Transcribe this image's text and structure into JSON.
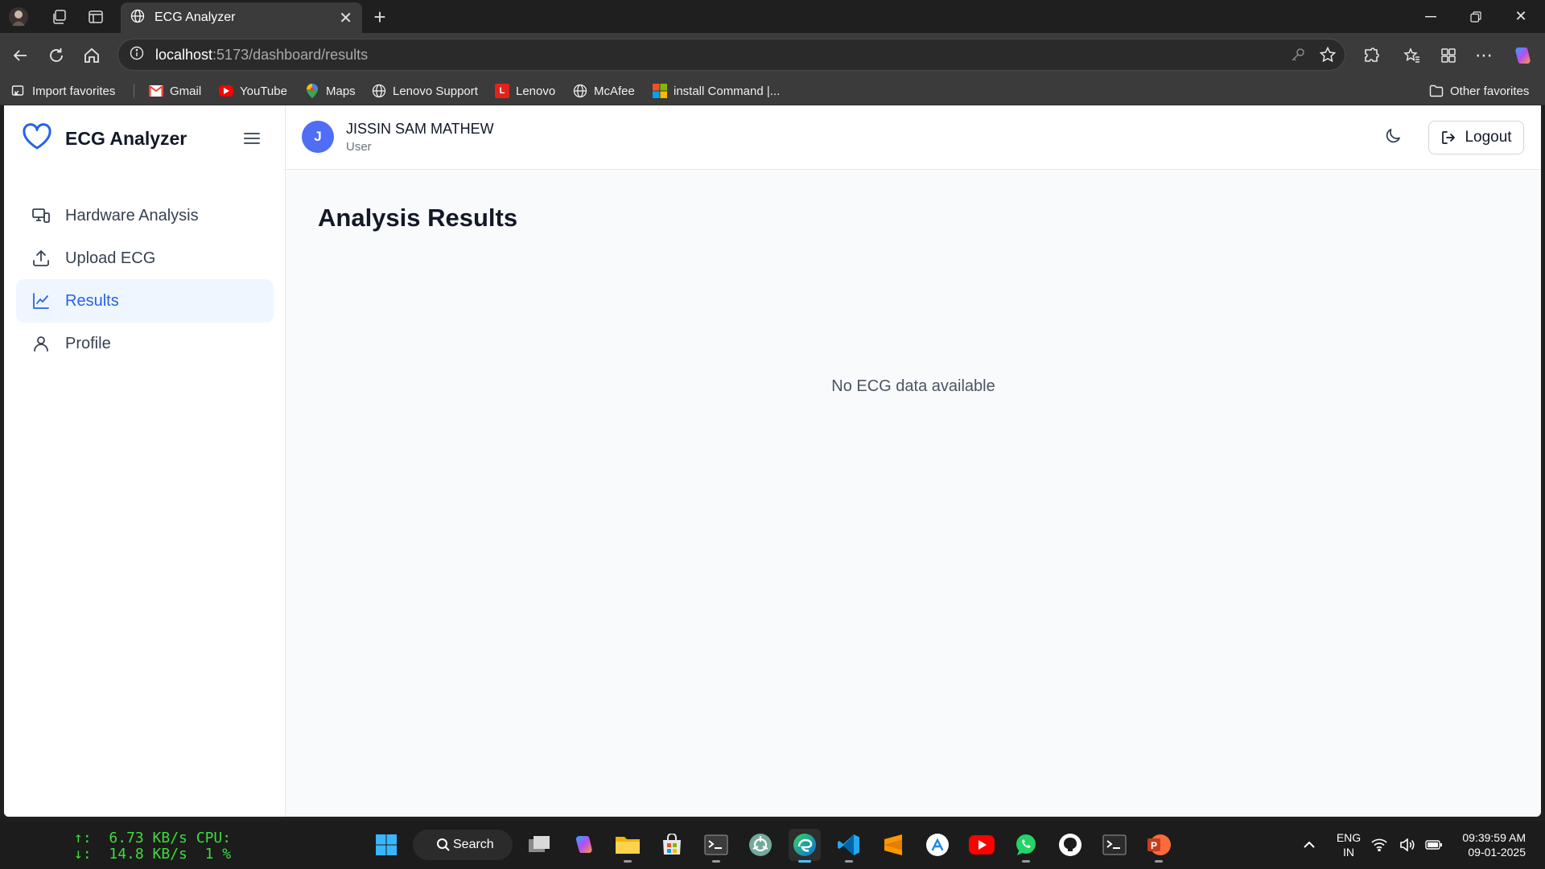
{
  "browser": {
    "tab_title": "ECG Analyzer",
    "url_host": "localhost",
    "url_path": ":5173/dashboard/results",
    "bookmarks": [
      {
        "label": "Import favorites",
        "icon": "import-icon"
      },
      {
        "label": "Gmail",
        "icon": "gmail-icon",
        "color": "#ea4335"
      },
      {
        "label": "YouTube",
        "icon": "youtube-icon",
        "color": "#ff0000"
      },
      {
        "label": "Maps",
        "icon": "maps-icon",
        "color": "#34a853"
      },
      {
        "label": "Lenovo Support",
        "icon": "globe-icon"
      },
      {
        "label": "Lenovo",
        "icon": "lenovo-icon",
        "color": "#e2231a"
      },
      {
        "label": "McAfee",
        "icon": "globe-icon"
      },
      {
        "label": "install Command |...",
        "icon": "microsoft-icon"
      }
    ],
    "other_favorites": "Other favorites"
  },
  "app": {
    "brand_name": "ECG Analyzer",
    "accent_color": "#2563eb",
    "sidebar": {
      "items": [
        {
          "label": "Hardware Analysis",
          "icon": "devices-icon",
          "active": false
        },
        {
          "label": "Upload ECG",
          "icon": "upload-icon",
          "active": false
        },
        {
          "label": "Results",
          "icon": "line-chart-icon",
          "active": true
        },
        {
          "label": "Profile",
          "icon": "user-icon",
          "active": false
        }
      ]
    },
    "header": {
      "avatar_initial": "J",
      "user_name": "JISSIN SAM MATHEW",
      "user_role": "User",
      "logout_label": "Logout"
    },
    "main": {
      "title": "Analysis Results",
      "empty_message": "No ECG data available"
    }
  },
  "taskbar": {
    "net_up": "6.73 KB/s",
    "net_down": "14.8 KB/s",
    "cpu_label": "CPU:",
    "cpu_value": "1 %",
    "search_label": "Search",
    "lang_top": "ENG",
    "lang_bottom": "IN",
    "time": "09:39:59 AM",
    "date": "09-01-2025"
  }
}
